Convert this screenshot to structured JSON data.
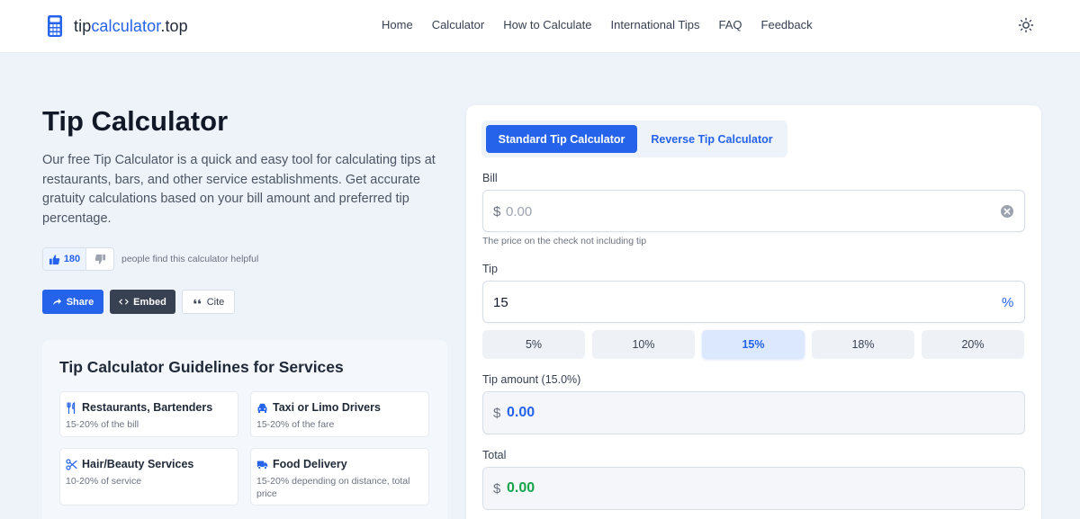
{
  "header": {
    "logo_part1": "tip",
    "logo_part2": "calculator",
    "logo_part3": ".top",
    "nav": [
      "Home",
      "Calculator",
      "How to Calculate",
      "International Tips",
      "FAQ",
      "Feedback"
    ],
    "theme_icon": "sun-icon"
  },
  "intro": {
    "title": "Tip Calculator",
    "description": "Our free Tip Calculator is a quick and easy tool for calculating tips at restaurants, bars, and other service establishments. Get accurate gratuity calculations based on your bill amount and preferred tip percentage.",
    "upvotes": "180",
    "helpful_text": "people find this calculator helpful",
    "share_label": "Share",
    "embed_label": "Embed",
    "cite_label": "Cite"
  },
  "guidelines": {
    "title": "Tip Calculator Guidelines for Services",
    "items": [
      {
        "icon": "utensils-icon",
        "title": "Restaurants, Bartenders",
        "desc": "15-20% of the bill"
      },
      {
        "icon": "car-icon",
        "title": "Taxi or Limo Drivers",
        "desc": "15-20% of the fare"
      },
      {
        "icon": "scissors-icon",
        "title": "Hair/Beauty Services",
        "desc": "10-20% of service"
      },
      {
        "icon": "truck-icon",
        "title": "Food Delivery",
        "desc": "15-20% depending on distance, total price"
      }
    ]
  },
  "calculator": {
    "tabs": [
      "Standard Tip Calculator",
      "Reverse Tip Calculator"
    ],
    "bill_label": "Bill",
    "currency": "$",
    "bill_placeholder": "0.00",
    "bill_value": "",
    "bill_hint": "The price on the check not including tip",
    "tip_label": "Tip",
    "tip_value": "15",
    "tip_unit": "%",
    "percent_options": [
      "5%",
      "10%",
      "15%",
      "18%",
      "20%"
    ],
    "selected_percent": "15%",
    "tip_amount_label": "Tip amount (15.0%)",
    "tip_amount": "0.00",
    "total_label": "Total",
    "total": "0.00"
  },
  "colors": {
    "accent": "#2563eb",
    "dark_button": "#374151",
    "total_green": "#16a34a",
    "page_bg": "#eef3fa"
  }
}
